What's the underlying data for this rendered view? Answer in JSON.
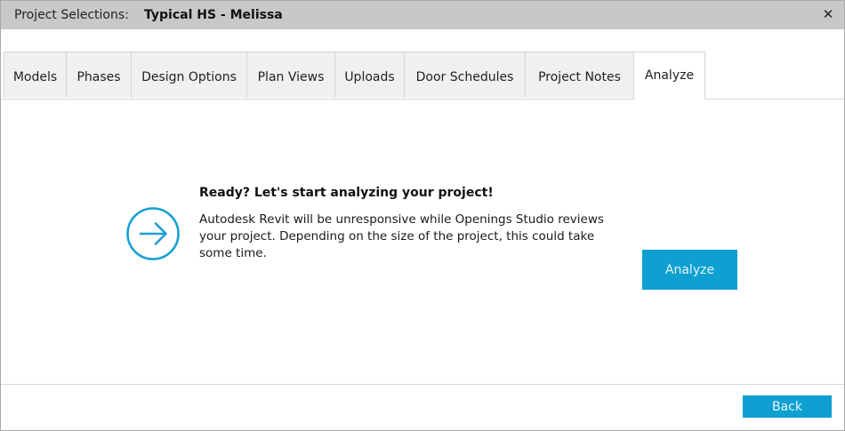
{
  "window": {
    "title_prefix": "Project Selections:",
    "project_name": "Typical HS - Melissa",
    "close_glyph": "✕"
  },
  "tabs": [
    {
      "label": "Models"
    },
    {
      "label": "Phases"
    },
    {
      "label": "Design Options"
    },
    {
      "label": "Plan Views"
    },
    {
      "label": "Uploads"
    },
    {
      "label": "Door Schedules"
    },
    {
      "label": "Project Notes"
    },
    {
      "label": "Analyze",
      "active": true
    }
  ],
  "analyze_panel": {
    "icon": "arrow-right-circle-icon",
    "heading": "Ready? Let's start analyzing your project!",
    "body": "Autodesk Revit will be unresponsive while Openings Studio reviews your project. Depending on the size of the project, this could take some time.",
    "button_label": "Analyze"
  },
  "footer": {
    "back_label": "Back"
  },
  "colors": {
    "accent": "#0fa0d2",
    "titlebar": "#c8c8c8",
    "tab_inactive": "#f0f0f0"
  }
}
